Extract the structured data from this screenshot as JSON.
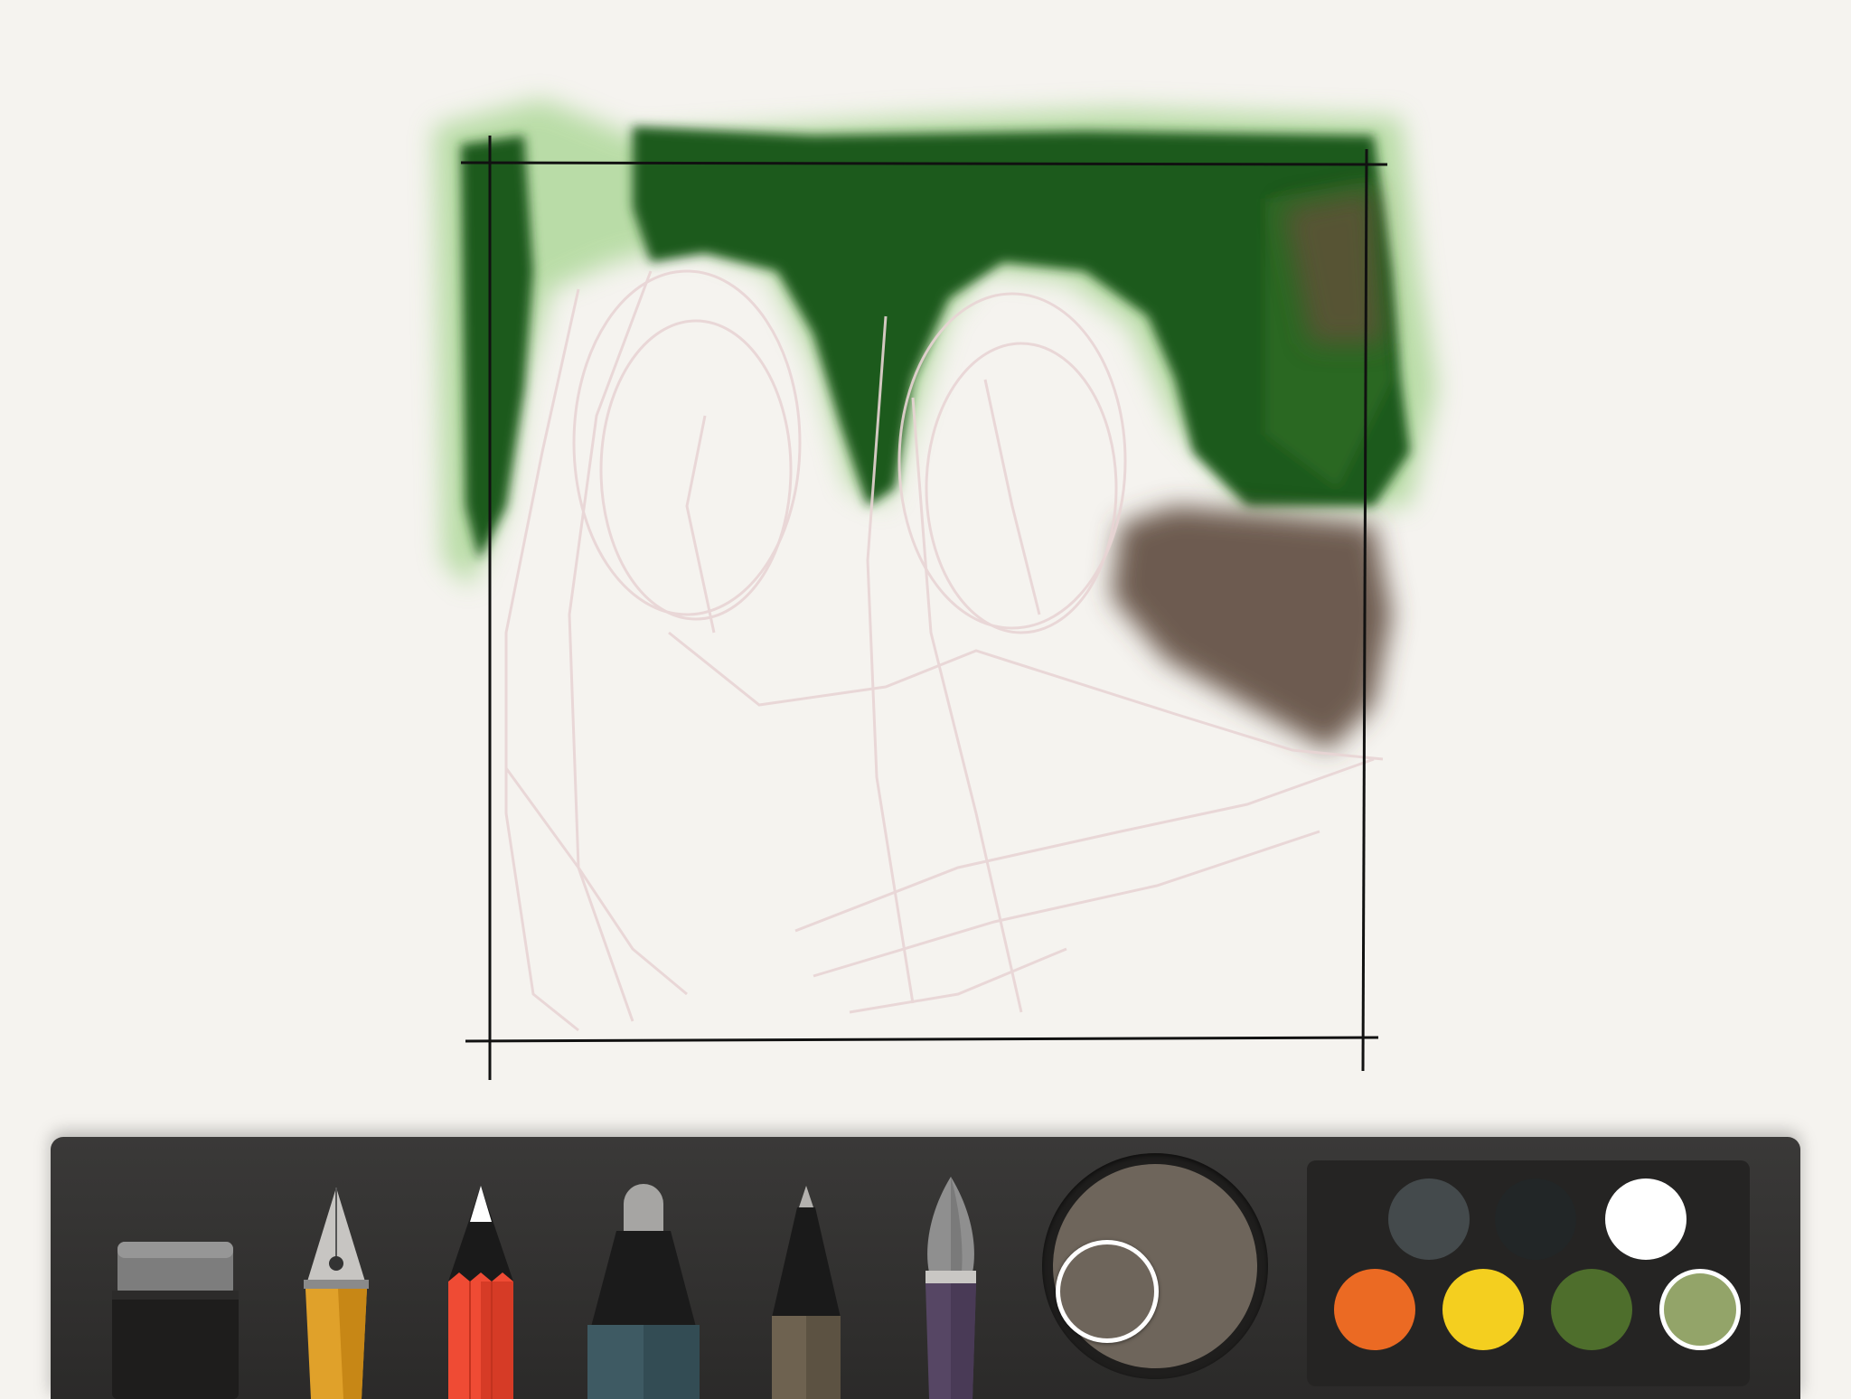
{
  "app": {
    "canvas": {
      "frame_color": "#111111",
      "sketch_color": "#e8d4d4",
      "foliage_dark": "#1f5a1c",
      "foliage_light": "#a6d58f",
      "trunk_brown": "#5e4a3d"
    },
    "toolbar": {
      "tools": [
        {
          "name": "eraser-tool",
          "icon": "eraser-icon"
        },
        {
          "name": "fountain-pen-tool",
          "icon": "fountain-pen-icon",
          "color": "#e0a12a"
        },
        {
          "name": "pencil-tool",
          "icon": "pencil-icon",
          "color": "#ef4b34"
        },
        {
          "name": "marker-tool",
          "icon": "marker-icon",
          "color": "#3e5a63"
        },
        {
          "name": "ballpoint-pen-tool",
          "icon": "ballpoint-pen-icon",
          "color": "#6e6250"
        },
        {
          "name": "watercolor-brush-tool",
          "icon": "brush-icon",
          "color": "#564664"
        }
      ],
      "current_color": "#6e655b",
      "palette": [
        {
          "name": "slate-gray",
          "color": "#444a4c"
        },
        {
          "name": "charcoal",
          "color": "#222627"
        },
        {
          "name": "white",
          "color": "#ffffff"
        },
        {
          "name": "orange",
          "color": "#eb6a23"
        },
        {
          "name": "yellow",
          "color": "#f4cf1f"
        },
        {
          "name": "leaf-green",
          "color": "#4e6e2c"
        },
        {
          "name": "sage-green",
          "color": "#93a469",
          "selected": true
        }
      ]
    }
  }
}
